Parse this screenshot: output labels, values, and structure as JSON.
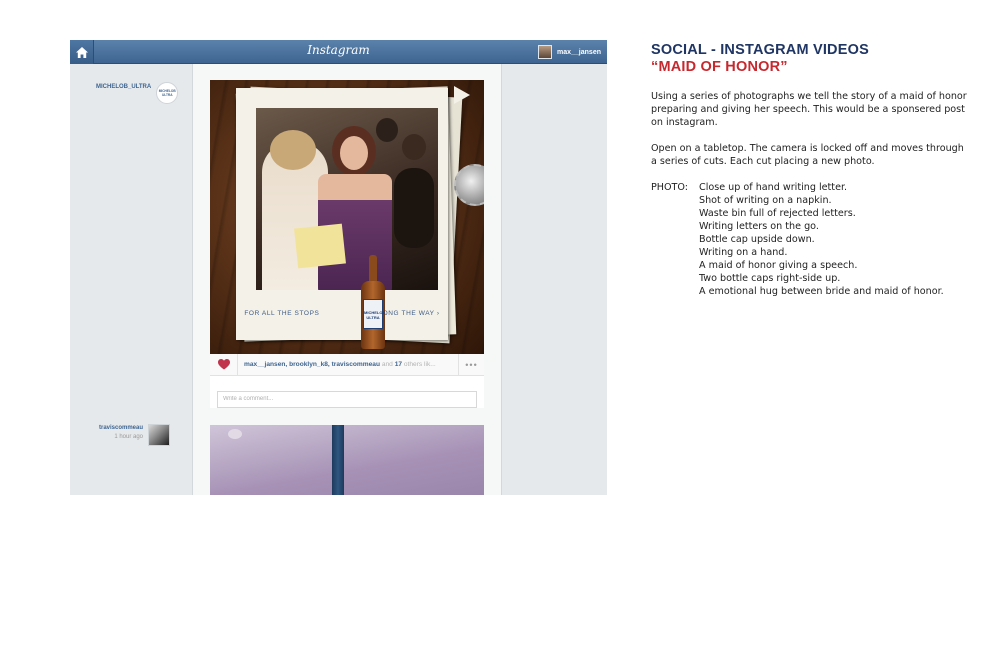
{
  "instagram": {
    "logo_text": "Instagram",
    "current_user": "max__jansen",
    "posts": [
      {
        "username": "MICHELOB_ULTRA",
        "avatar_text": "MICHELOB ULTRA",
        "photo_tagline_left": "FOR ALL THE STOPS",
        "photo_tagline_right": "ALONG THE WAY ›",
        "bottle_label": "MICHELOB ULTRA",
        "likes_names": "max__jansen, brooklyn_k8, traviscommeau",
        "likes_and": "and",
        "likes_count": "17",
        "likes_suffix": "others lik...",
        "comment_placeholder": "Write a comment..."
      },
      {
        "username": "traviscommeau",
        "time": "1 hour ago"
      }
    ]
  },
  "script": {
    "title_line1": "SOCIAL - INSTAGRAM VIDEOS",
    "title_line2": "“MAID OF HONOR”",
    "paragraph1": "Using a series of photographs we tell the story of a maid of honor preparing and giving her speech. This would be a sponsered post on instagram.",
    "paragraph2": "Open on a tabletop. The camera is locked off and moves through a series of cuts. Each cut placing a new photo.",
    "photo_label": "PHOTO:",
    "photo_shots": [
      "Close up of hand writing letter.",
      "Shot of writing on a napkin.",
      "Waste bin full of rejected letters.",
      "Writing letters on the go.",
      "Bottle cap upside down.",
      "Writing on a hand.",
      "A maid of honor giving a speech.",
      "Two bottle caps right-side up.",
      "A emotional hug between bride and maid of honor."
    ]
  },
  "colors": {
    "title_navy": "#1f3563",
    "title_red": "#c7282e",
    "instagram_blue": "#3e6591",
    "heart_red": "#c0334a"
  },
  "icons": [
    "home-icon",
    "heart-icon",
    "more-dots-icon"
  ]
}
